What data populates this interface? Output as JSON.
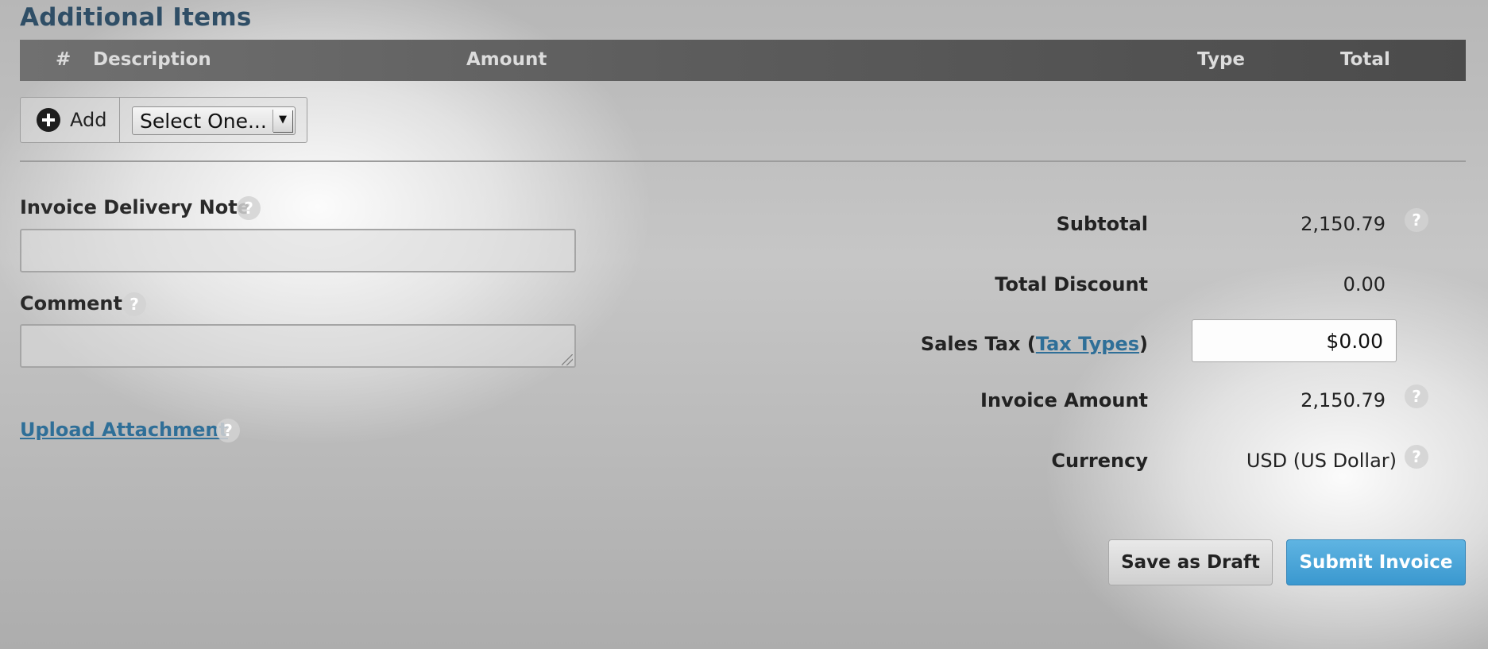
{
  "section": {
    "title": "Additional Items"
  },
  "items_table": {
    "columns": [
      "#",
      "Description",
      "Amount",
      "Type",
      "Total"
    ]
  },
  "toolbar": {
    "add_label": "Add",
    "item_type_select": "Select One..."
  },
  "left_form": {
    "delivery_note_label": "Invoice Delivery Note",
    "delivery_note_value": "",
    "comment_label": "Comment",
    "comment_value": "",
    "upload_link": "Upload Attachment"
  },
  "summary": {
    "subtotal_label": "Subtotal",
    "subtotal_value": "2,150.79",
    "discount_label": "Total Discount",
    "discount_value": "0.00",
    "sales_tax_label": "Sales Tax (",
    "tax_types_link": "Tax Types",
    "sales_tax_close": ")",
    "sales_tax_value": "$0.00",
    "invoice_amount_label": "Invoice Amount",
    "invoice_amount_value": "2,150.79",
    "currency_label": "Currency",
    "currency_value": "USD (US Dollar)"
  },
  "actions": {
    "save_draft": "Save as Draft",
    "submit": "Submit Invoice"
  },
  "help_glyph": "?",
  "select_arrow_glyph": "▼",
  "colors": {
    "title": "#2f4e66",
    "link": "#2f6f98",
    "header_bg": "#5d5d5d",
    "submit_bg": "#3a98cf"
  }
}
